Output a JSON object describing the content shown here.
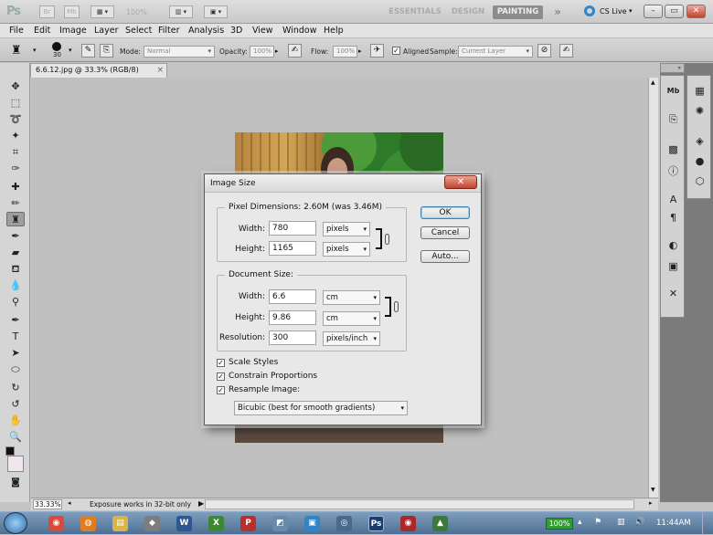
{
  "app": {
    "logo": "Ps",
    "buttons": [
      "Br",
      "Mb"
    ],
    "zoom": "100%",
    "workspaces": [
      "ESSENTIALS",
      "DESIGN",
      "PAINTING"
    ],
    "active_workspace": "PAINTING",
    "more": "»",
    "cslive": "CS Live",
    "win_min": "–",
    "win_max": "▭",
    "win_close": "✕"
  },
  "menu": [
    "File",
    "Edit",
    "Image",
    "Layer",
    "Select",
    "Filter",
    "Analysis",
    "3D",
    "View",
    "Window",
    "Help"
  ],
  "options": {
    "brush_size": "30",
    "mode_label": "Mode:",
    "mode_value": "Normal",
    "opacity_label": "Opacity:",
    "opacity_value": "100%",
    "flow_label": "Flow:",
    "flow_value": "100%",
    "aligned_label": "Aligned",
    "sample_label": "Sample:",
    "sample_value": "Current Layer"
  },
  "document": {
    "tab_title": "6.6.12.jpg @ 33.3% (RGB/8)",
    "close": "×"
  },
  "status": {
    "zoom": "33.33%",
    "info": "Exposure works in 32-bit only"
  },
  "dialog": {
    "title": "Image Size",
    "close": "✕",
    "pixel_dimensions_label": "Pixel Dimensions:",
    "pixel_dimensions_value": "2.60M (was 3.46M)",
    "width_label": "Width:",
    "width_value": "780",
    "width_unit": "pixels",
    "height_label": "Height:",
    "height_value": "1165",
    "height_unit": "pixels",
    "document_size_label": "Document Size:",
    "doc_width_label": "Width:",
    "doc_width_value": "6.6",
    "doc_width_unit": "cm",
    "doc_height_label": "Height:",
    "doc_height_value": "9.86",
    "doc_height_unit": "cm",
    "resolution_label": "Resolution:",
    "resolution_value": "300",
    "resolution_unit": "pixels/inch",
    "scale_styles": "Scale Styles",
    "constrain": "Constrain Proportions",
    "resample": "Resample Image:",
    "resample_method": "Bicubic (best for smooth gradients)",
    "ok": "OK",
    "cancel": "Cancel",
    "auto": "Auto..."
  },
  "taskbar": {
    "battery": "100%",
    "time": "11:44AM"
  }
}
